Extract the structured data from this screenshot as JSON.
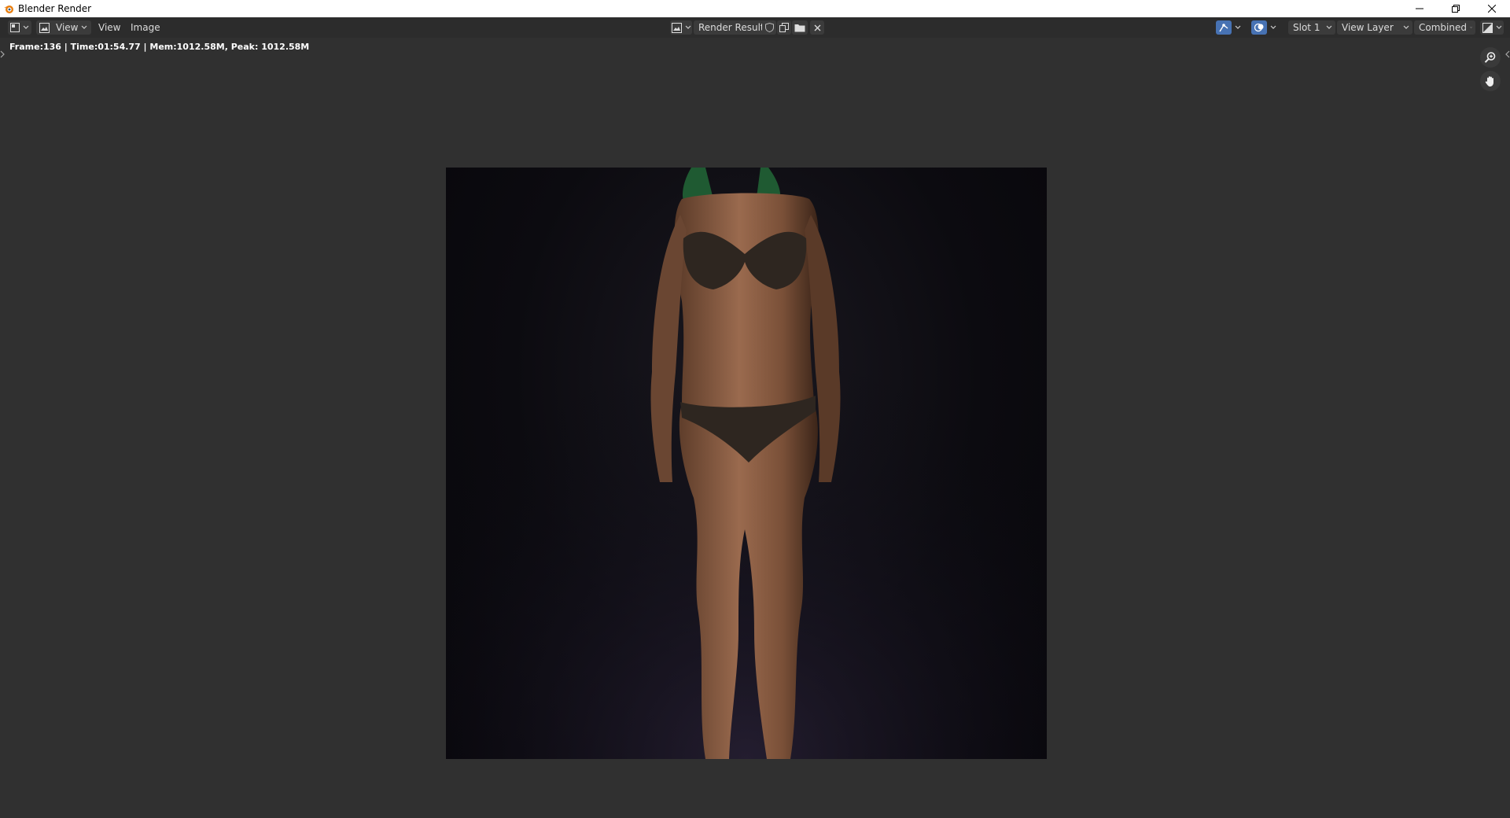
{
  "window": {
    "title": "Blender Render",
    "controls": [
      "minimize-icon",
      "restore-icon",
      "close-icon"
    ]
  },
  "header": {
    "left_menus": [
      {
        "name": "View",
        "has_dropdown": true
      },
      {
        "name": "View"
      },
      {
        "name": "Image"
      }
    ],
    "image_name": "Render Result",
    "slot": "Slot 1",
    "view_layer": "View Layer",
    "pass": "Combined",
    "accent_color": "#4772b3"
  },
  "status": {
    "text": "Frame:136 | Time:01:54.77 | Mem:1012.58M, Peak: 1012.58M"
  },
  "navigation": {
    "tools": [
      "zoom-icon",
      "hand-pan-icon"
    ]
  },
  "render_image": {
    "description_icon": "render-result-image"
  }
}
